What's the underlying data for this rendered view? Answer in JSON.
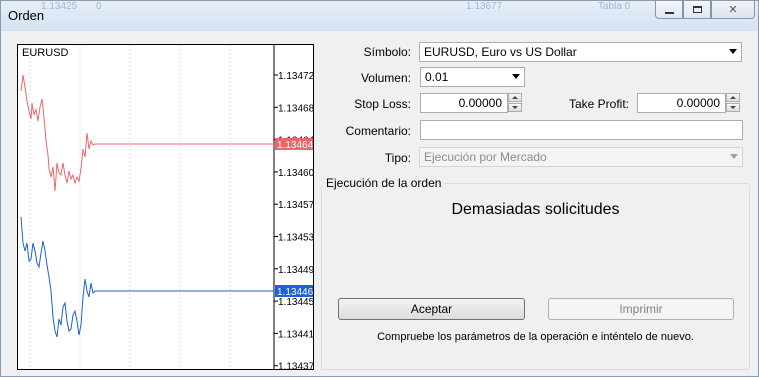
{
  "window": {
    "title": "Orden",
    "background_text": [
      "1.13425",
      "0",
      "1.13677",
      "Tabla 0"
    ]
  },
  "chart": {
    "symbol": "EURUSD",
    "price_ticks": [
      "1.13472",
      "1.13468",
      "1.13464",
      "1.13460",
      "1.13457",
      "1.13453",
      "1.13449",
      "1.13445",
      "1.13441",
      "1.13437"
    ],
    "bid_price": "1.13446",
    "ask_price": "1.13464",
    "ask_color": "#e8686b",
    "bid_color": "#1f5fd8"
  },
  "form": {
    "symbol_label": "Símbolo:",
    "symbol_value": "EURUSD, Euro vs US Dollar",
    "volume_label": "Volumen:",
    "volume_value": "0.01",
    "stoploss_label": "Stop Loss:",
    "stoploss_value": "0.00000",
    "takeprofit_label": "Take Profit:",
    "takeprofit_value": "0.00000",
    "comment_label": "Comentario:",
    "comment_value": "",
    "type_label": "Tipo:",
    "type_value": "Ejecución por Mercado"
  },
  "execution": {
    "group_title": "Ejecución de la orden",
    "message": "Demasiadas solicitudes",
    "accept_label": "Aceptar",
    "print_label": "Imprimir",
    "hint": "Compruebe los parámetros de la operación e inténtelo de nuevo."
  }
}
